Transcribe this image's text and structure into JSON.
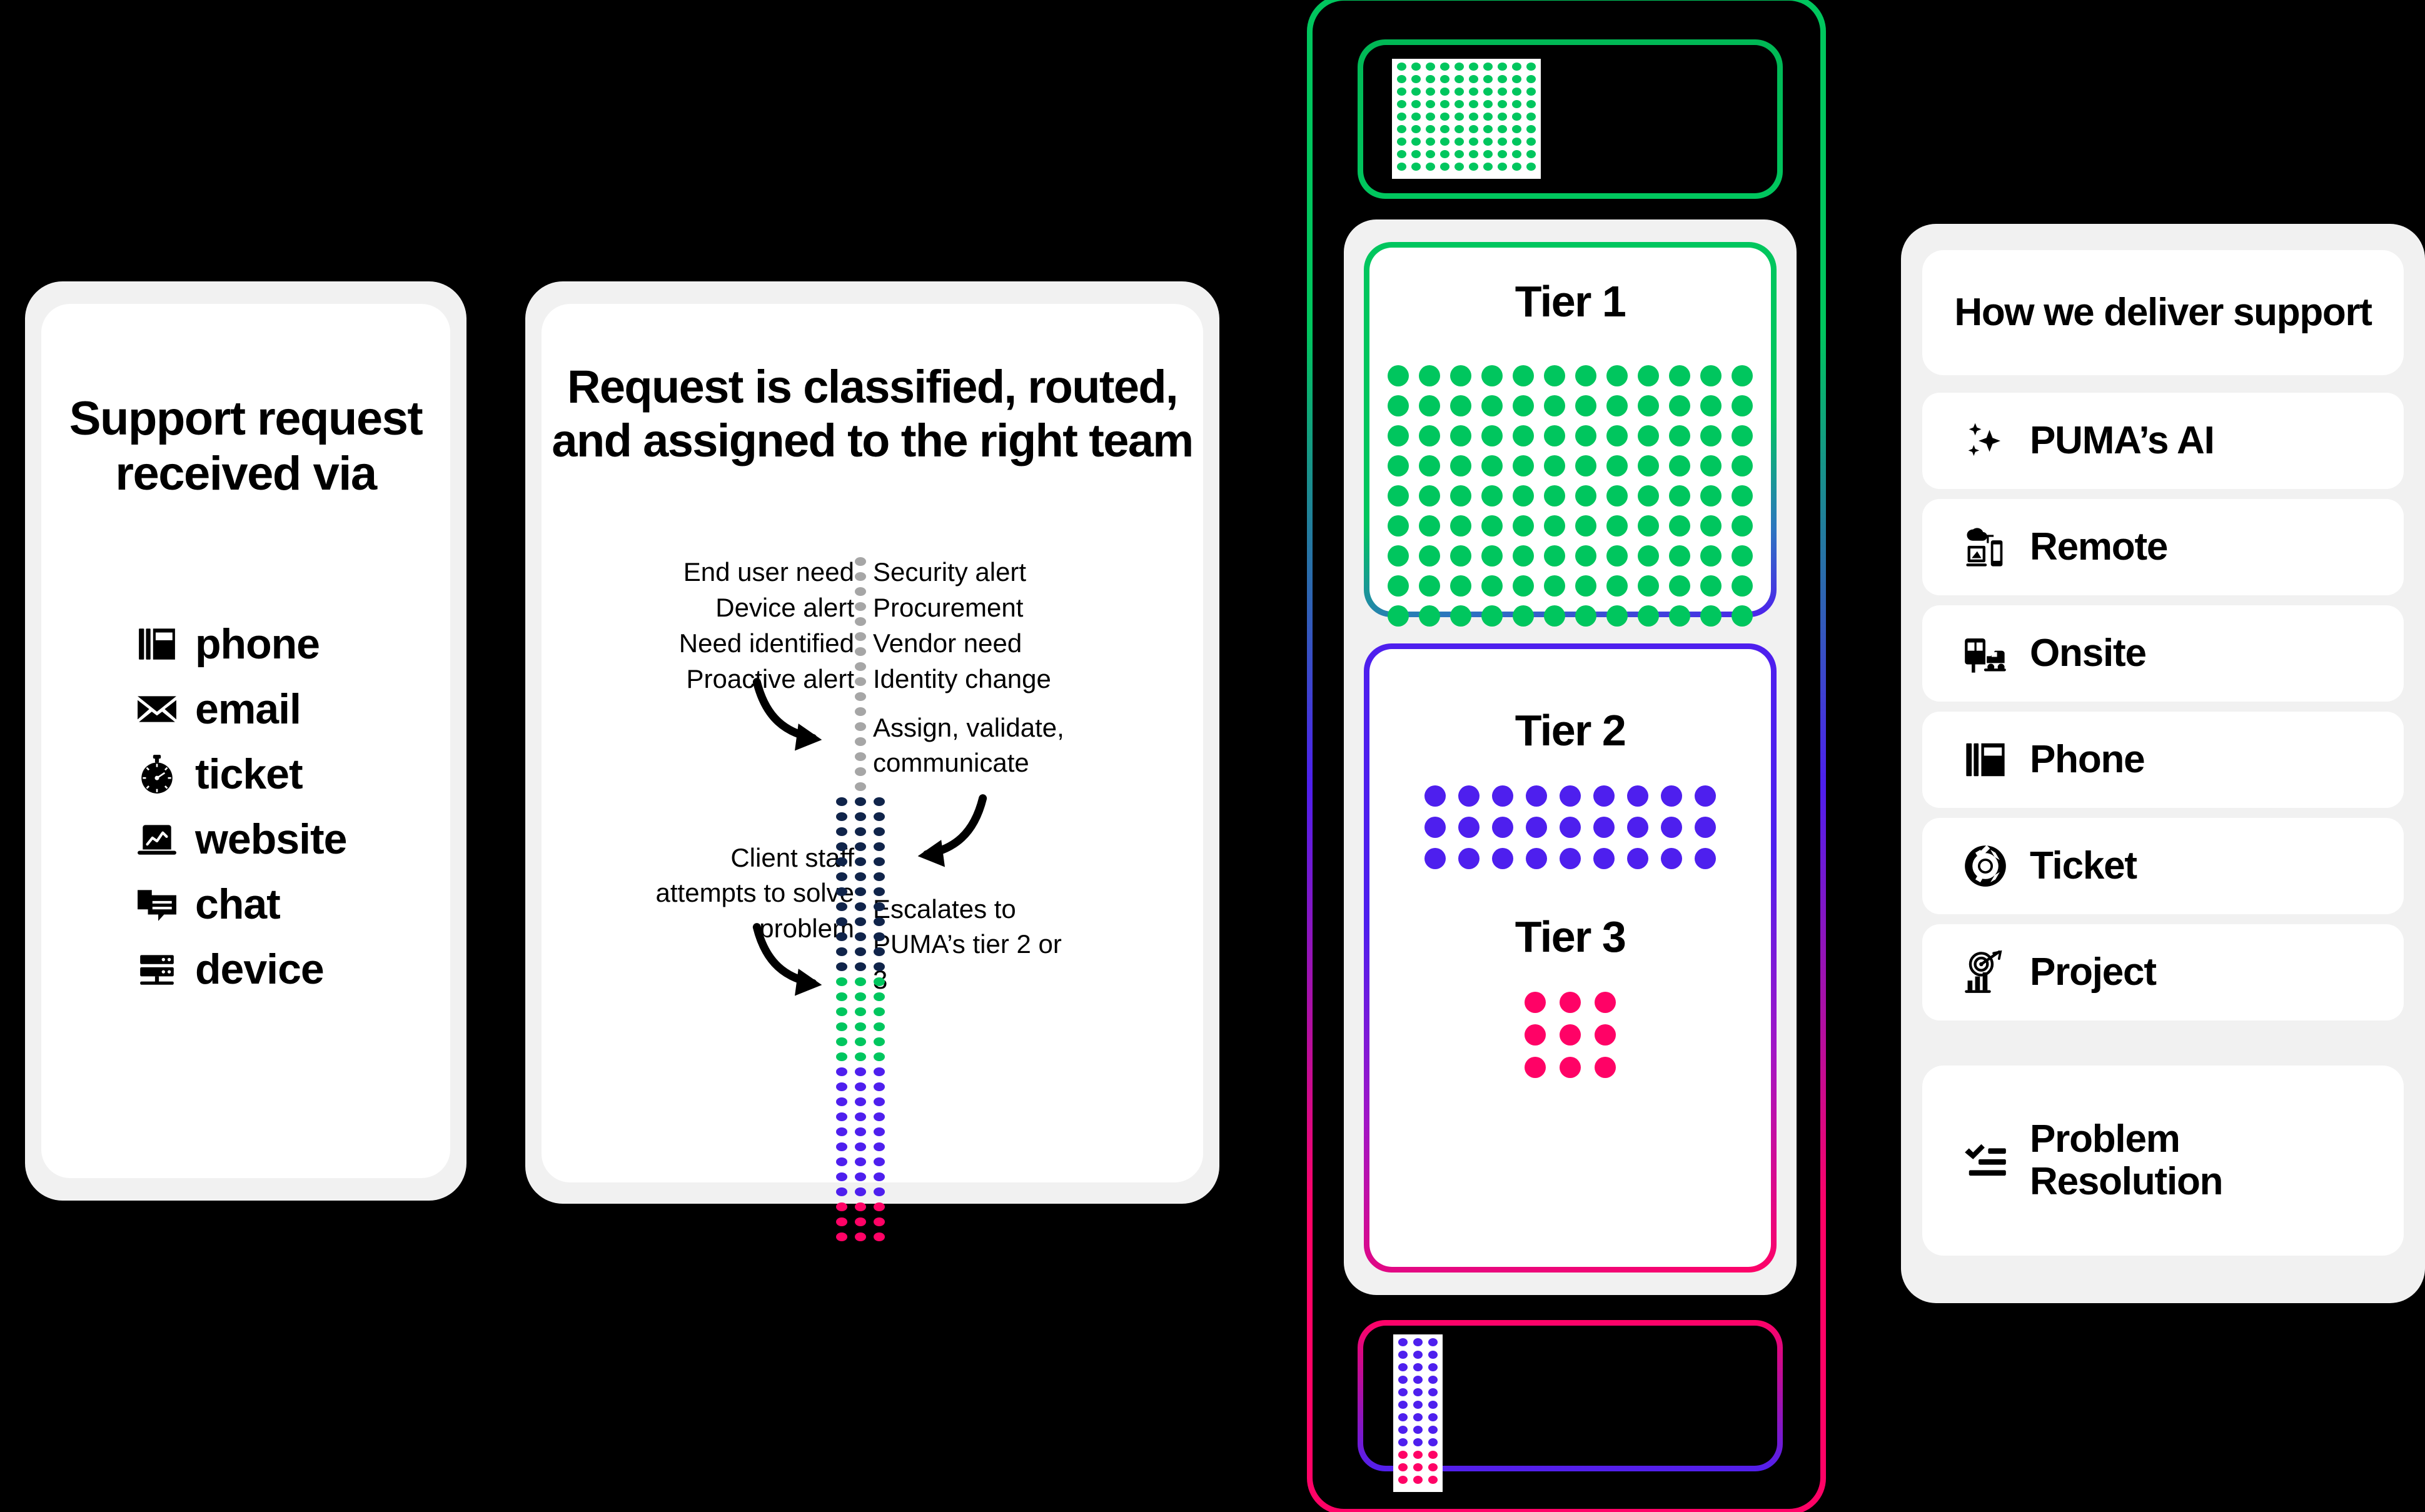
{
  "theme": {
    "background": "#000000",
    "card_outer": "#F1F1F1",
    "card_inner": "#FFFFFF",
    "green": "#00C65E",
    "blue": "#4E1FEE",
    "pink": "#FF0266",
    "navy": "#10244A",
    "grey_dot": "#A6A6A6"
  },
  "intake": {
    "title": "Support request received via",
    "items": [
      {
        "icon": "desk-phone-icon",
        "label": "phone"
      },
      {
        "icon": "envelope-icon",
        "label": "email"
      },
      {
        "icon": "stopwatch-icon",
        "label": "ticket"
      },
      {
        "icon": "laptop-chart-icon",
        "label": "website"
      },
      {
        "icon": "chat-bubbles-icon",
        "label": "chat"
      },
      {
        "icon": "server-device-icon",
        "label": "device"
      }
    ]
  },
  "routing": {
    "title": "Request is classified, routed, and assigned to the right team",
    "left_sources": "End user need\nDevice alert\nNeed identified\nProactive alert",
    "right_sources": "Security alert\nProcurement\nVendor need\nIdentity change",
    "note_assign": "Assign, validate, communicate",
    "note_client": "Client staff attempts to solve problem",
    "note_escalate": "Escalates to PUMA’s tier 2 or 3",
    "spine": {
      "segments": [
        {
          "name": "incoming",
          "color": "#A6A6A6",
          "rows": 16,
          "cols": 1
        },
        {
          "name": "assigned",
          "color": "#10244A",
          "rows": 12,
          "cols": 3
        },
        {
          "name": "client-solved",
          "color": "#00C65E",
          "rows": 6,
          "cols": 3
        },
        {
          "name": "tier-2",
          "color": "#4E1FEE",
          "rows": 9,
          "cols": 3
        },
        {
          "name": "tier-3",
          "color": "#FF0266",
          "rows": 3,
          "cols": 3
        }
      ]
    }
  },
  "tiers": {
    "stub_top": {
      "color": "#00C65E",
      "rows": 9,
      "cols": 10
    },
    "stub_bottom": {
      "segments": [
        {
          "color": "#4E1FEE",
          "rows": 9,
          "cols": 3
        },
        {
          "color": "#FF0266",
          "rows": 3,
          "cols": 3
        }
      ]
    },
    "cards": [
      {
        "heading": "Tier 1",
        "color": "#00C65E",
        "rows": 9,
        "cols": 12
      },
      {
        "heading": "Tier 2",
        "color": "#4E1FEE",
        "rows": 3,
        "cols": 9
      },
      {
        "heading": "Tier 3",
        "color": "#FF0266",
        "rows": 3,
        "cols": 3
      }
    ]
  },
  "deliver": {
    "title": "How we deliver support",
    "items": [
      {
        "icon": "sparkles-ai-icon",
        "label": "PUMA’s AI"
      },
      {
        "icon": "cloud-remote-icon",
        "label": "Remote"
      },
      {
        "icon": "van-car-onsite-icon",
        "label": "Onsite"
      },
      {
        "icon": "desk-phone-icon",
        "label": "Phone"
      },
      {
        "icon": "lifebuoy-ticket-icon",
        "label": "Ticket"
      },
      {
        "icon": "target-chart-project-icon",
        "label": "Project"
      }
    ],
    "footer": {
      "icon": "checklist-icon",
      "label": "Problem\nResolution"
    }
  }
}
